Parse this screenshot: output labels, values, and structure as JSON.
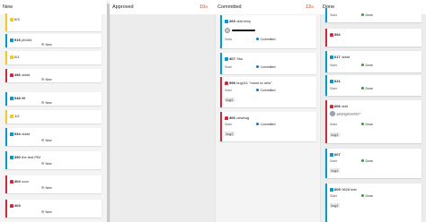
{
  "columns": {
    "new": {
      "label": "New"
    },
    "approved": {
      "label": "Approved",
      "count": "10",
      "limit": "/5"
    },
    "committed": {
      "label": "Committed",
      "count": "13",
      "limit": "/5"
    },
    "done": {
      "label": "Done"
    }
  },
  "labels": {
    "state": "State"
  },
  "new_cards": [
    {
      "type": "feature",
      "id": "",
      "title": "0/3",
      "state": ""
    },
    {
      "type": "story",
      "id": "515",
      "title": "pb444",
      "state": "New"
    },
    {
      "type": "feature",
      "id": "",
      "title": "0/1",
      "state": ""
    },
    {
      "type": "bug",
      "id": "496",
      "title": "dddd",
      "state": "New"
    },
    {
      "type": "story",
      "id": "548",
      "title": "ffff",
      "state": "New"
    },
    {
      "type": "feature",
      "id": "",
      "title": "1/2",
      "state": ""
    },
    {
      "type": "story",
      "id": "534",
      "title": "dddd",
      "state": "New"
    },
    {
      "type": "story",
      "id": "350",
      "title": "the test PBI",
      "state": "New"
    },
    {
      "type": "bug",
      "id": "404",
      "title": "cccc",
      "state": "New"
    },
    {
      "type": "bug",
      "id": "403",
      "title": "",
      "state": "New"
    }
  ],
  "committed_cards": [
    {
      "type": "story",
      "id": "269",
      "title": "ddd retry",
      "state": "Committed",
      "tag": ""
    },
    {
      "type": "story",
      "id": "407",
      "title": "Sss",
      "state": "Committed",
      "tag": ""
    },
    {
      "type": "bug",
      "id": "598",
      "title": "bug111 \"move to new\"",
      "state": "Committed",
      "tag": "bug1"
    },
    {
      "type": "bug",
      "id": "306",
      "title": "newbug",
      "state": "Committed",
      "tag": "bug1"
    }
  ],
  "done_cards": [
    {
      "type": "story",
      "id": "",
      "title": "",
      "state": "Done",
      "tag": ""
    },
    {
      "type": "bug",
      "id": "592",
      "title": "",
      "state": "",
      "tag": ""
    },
    {
      "type": "story",
      "id": "617",
      "title": "dddd",
      "state": "Done",
      "tag": ""
    },
    {
      "type": "story",
      "id": "621",
      "title": "",
      "state": "Done",
      "tag": ""
    },
    {
      "type": "bug",
      "id": "606",
      "title": "ddd",
      "state": "Done",
      "tag": "bug1",
      "assignee": "yanjingzhou0927"
    },
    {
      "type": "story",
      "id": "607",
      "title": "",
      "state": "Done",
      "tag": "bug1"
    },
    {
      "type": "story",
      "id": "609",
      "title": "0828 test",
      "state": "Done",
      "tag": "bug1"
    }
  ]
}
